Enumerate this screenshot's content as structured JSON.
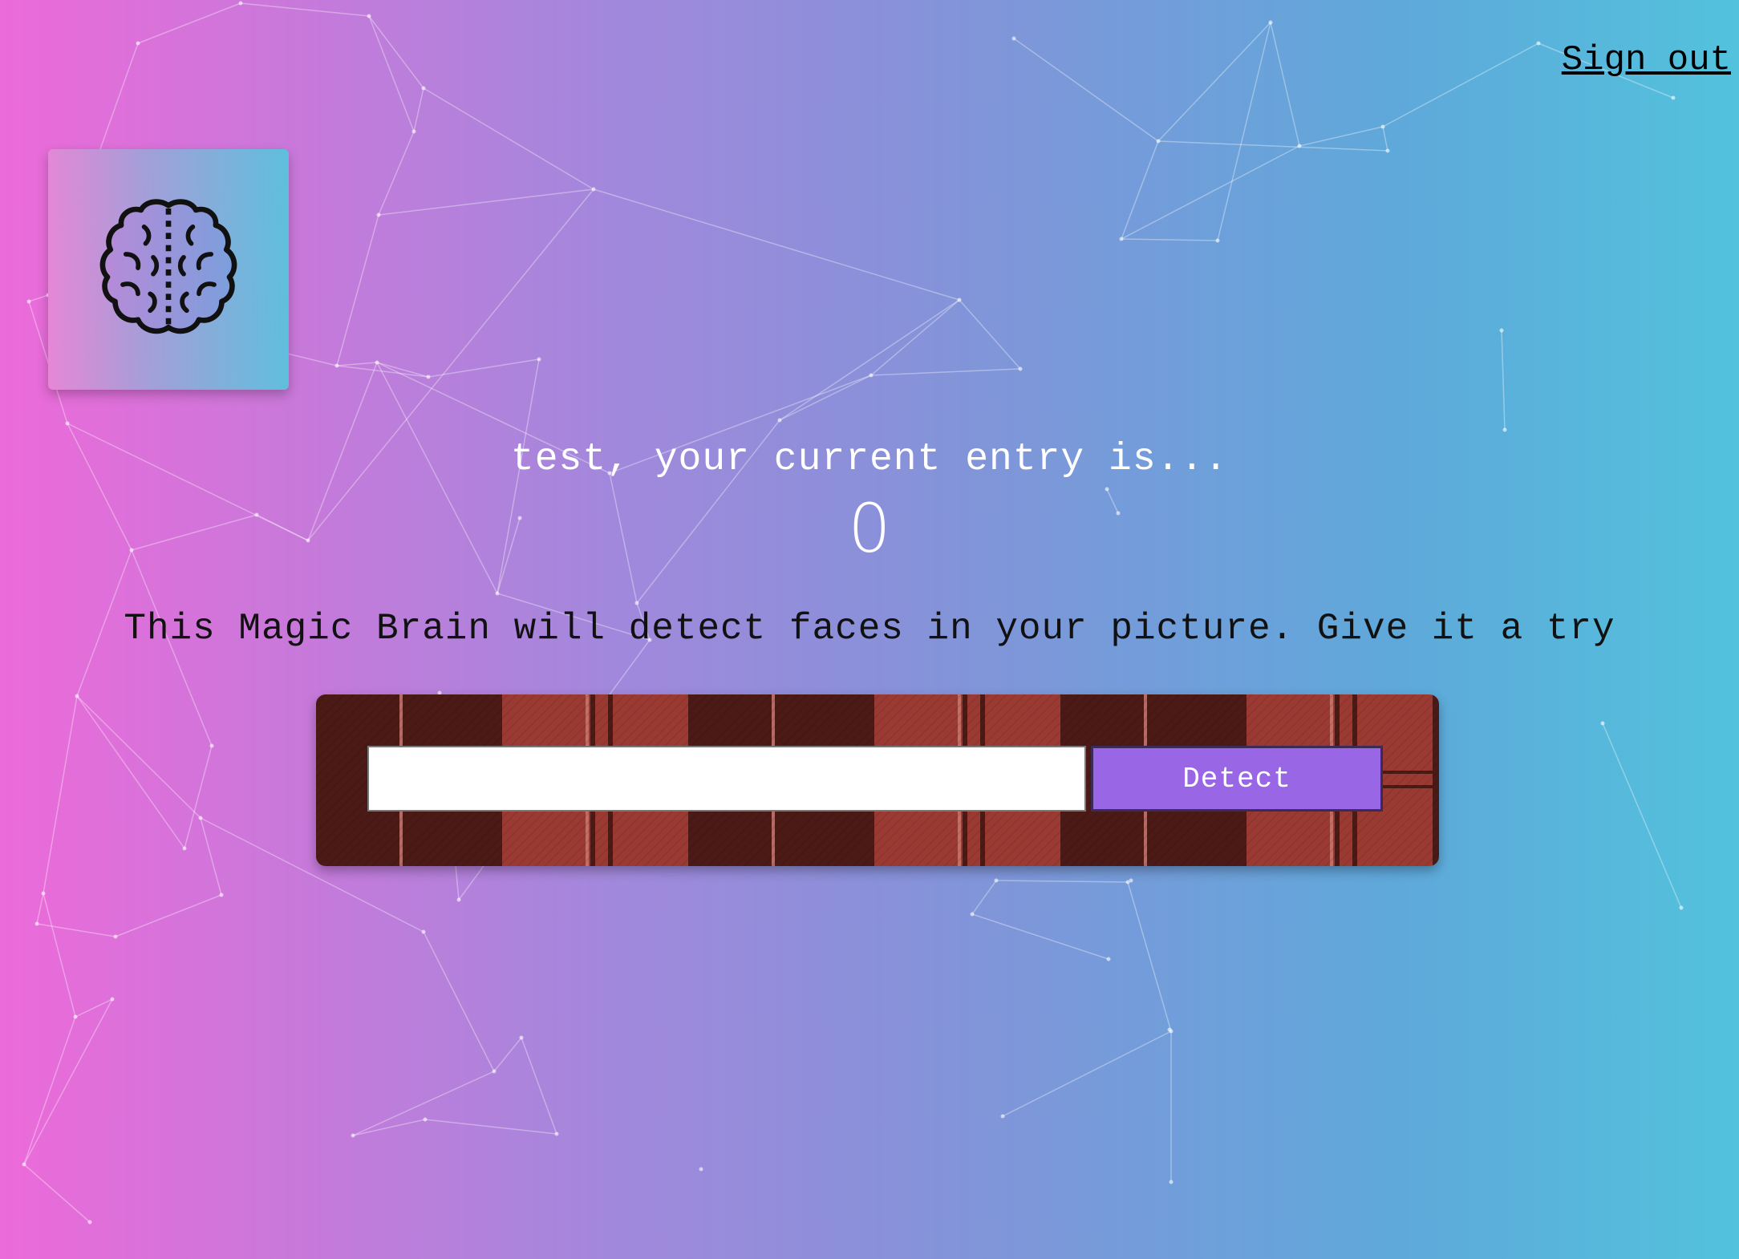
{
  "nav": {
    "signout_label": "Sign out"
  },
  "logo": {
    "icon": "brain-icon"
  },
  "rank": {
    "message": "test, your current entry is...",
    "count": "0"
  },
  "description": "This Magic Brain will detect faces in your picture. Give it a try",
  "form": {
    "input_value": "",
    "input_placeholder": "",
    "detect_label": "Detect"
  },
  "colors": {
    "gradient_left": "#ec6ad9",
    "gradient_right": "#52c2dd",
    "button": "#9966e6"
  }
}
